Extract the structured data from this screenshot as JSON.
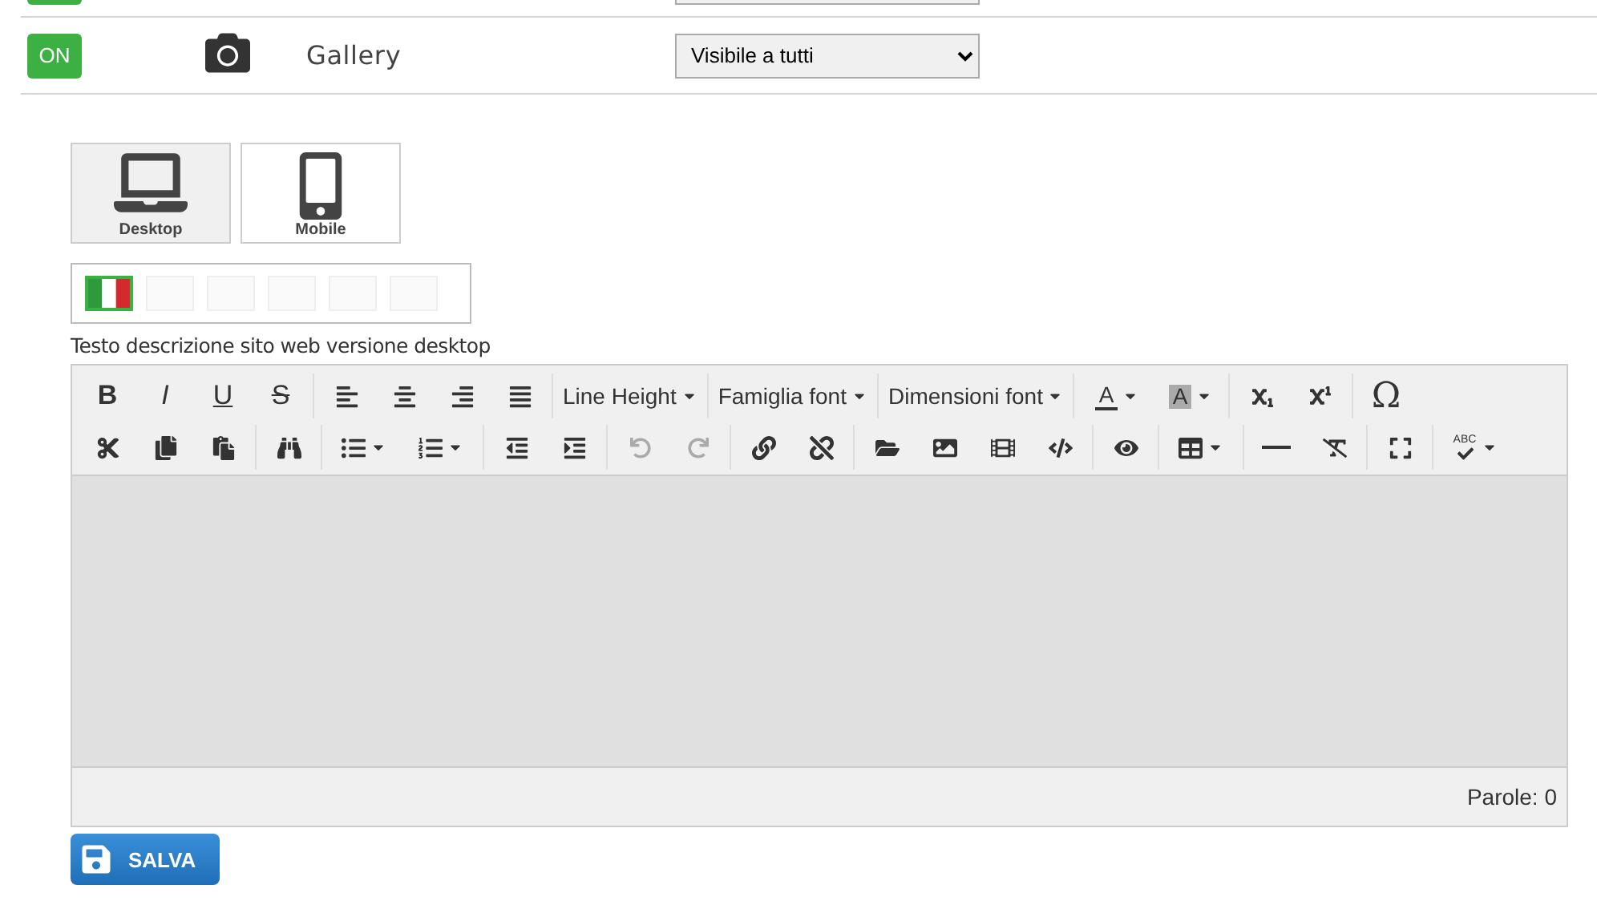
{
  "gallery_row": {
    "on": true,
    "toggle_label": "ON",
    "name": "Gallery",
    "visibility": "Visibile a tutti"
  },
  "devices": [
    {
      "label": "Desktop",
      "kind": "desktop",
      "selected": true
    },
    {
      "label": "Mobile",
      "kind": "mobile",
      "selected": false
    }
  ],
  "language_slots": [
    {
      "kind": "flag",
      "selected": true
    },
    {
      "kind": "empty",
      "selected": false
    },
    {
      "kind": "empty",
      "selected": false
    },
    {
      "kind": "empty",
      "selected": false
    },
    {
      "kind": "empty",
      "selected": false
    },
    {
      "kind": "empty",
      "selected": false
    }
  ],
  "editor_label": "Testo descrizione sito web versione desktop",
  "toolbar": {
    "bold": "B",
    "italic": "I",
    "underline": "U",
    "strike": "S",
    "line_height": "Line Height",
    "font_family": "Famiglia font",
    "font_size": "Dimensioni font",
    "font_color": "A",
    "back_color": "A",
    "special_chars": "Ω",
    "spellcheck": "ABC",
    "undo_disabled": true,
    "redo_disabled": true
  },
  "status": "Parole: 0",
  "save_button": "SALVA"
}
